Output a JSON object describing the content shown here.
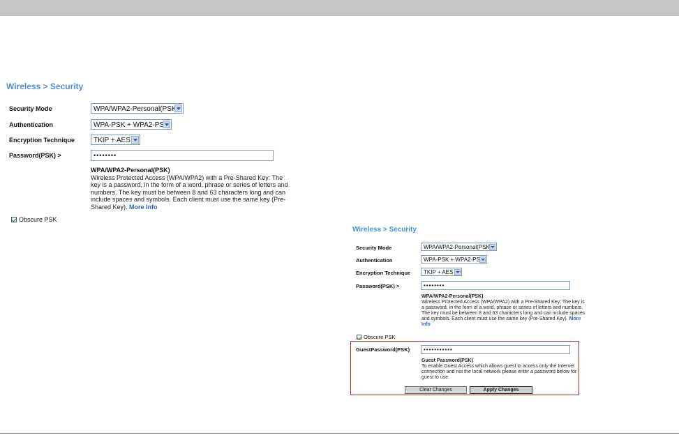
{
  "left_panel": {
    "breadcrumb": "Wireless > Security",
    "security_mode": {
      "label": "Security Mode",
      "value": "WPA/WPA2-Personal(PSK)"
    },
    "authentication": {
      "label": "Authentication",
      "value": "WPA-PSK + WPA2-PSK"
    },
    "encryption": {
      "label": "Encryption Technique",
      "value": "TKIP + AES"
    },
    "password": {
      "label": "Password(PSK) >",
      "value": "••••••••"
    },
    "description": {
      "title": "WPA/WPA2-Personal(PSK)",
      "body": "Wireless Protected Access (WPA/WPA2) with a Pre-Shared Key: The key is a password, in the form of a word, phrase or series of letters and numbers. The key must be between 8 and 63 characters long and can include spaces and symbols. Each client must use the same key (Pre-Shared Key).",
      "more_info": "More Info"
    },
    "obscure_psk": {
      "label": "Obscure PSK",
      "checked": true
    }
  },
  "right_panel": {
    "breadcrumb": "Wireless > Security",
    "security_mode": {
      "label": "Security Mode",
      "value": "WPA/WPA2-Personal(PSK)"
    },
    "authentication": {
      "label": "Authentication",
      "value": "WPA-PSK + WPA2-PSK"
    },
    "encryption": {
      "label": "Encryption Technique",
      "value": "TKIP + AES"
    },
    "password": {
      "label": "Password(PSK) >",
      "value": "••••••••"
    },
    "description": {
      "title": "WPA/WPA2-Personal(PSK)",
      "body": "Wireless Protected Access (WPA/WPA2) with a Pre-Shared Key: The key is a password, in the form of a word, phrase or series of letters and numbers. The key must be between 8 and 63 characters long and can include spaces and symbols. Each client must use the same key (Pre-Shared Key).",
      "more_info": "More Info"
    },
    "obscure_psk": {
      "label": "Obscure PSK",
      "checked": true
    },
    "guest_password": {
      "label": "GuestPassword(PSK)",
      "value": "•••••••••••",
      "title": "Guest Password(PSK)",
      "body": "To enable Guest Access which allows guest to access only the Internet connection and not the local network please enter a password below for guest to use."
    },
    "buttons": {
      "clear": "Clear Changes",
      "apply": "Apply Changes"
    }
  },
  "colors": {
    "accent": "#4c8fd4",
    "highlight": "#b22a2a",
    "link": "#2d64b9"
  }
}
